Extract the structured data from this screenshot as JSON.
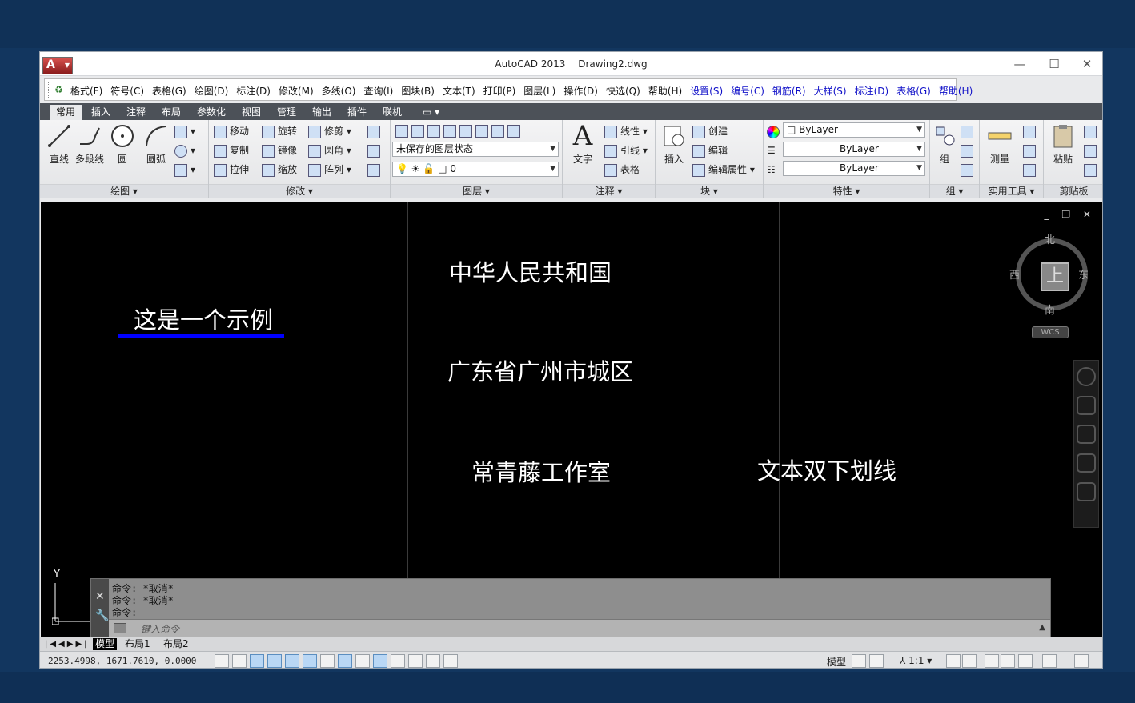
{
  "window": {
    "app_name": "AutoCAD 2013",
    "file_name": "Drawing2.dwg",
    "min_glyph": "—",
    "max_glyph": "☐",
    "close_glyph": "✕"
  },
  "menubar": {
    "items": [
      {
        "label": "格式(F)",
        "color": "black"
      },
      {
        "label": "符号(C)",
        "color": "black"
      },
      {
        "label": "表格(G)",
        "color": "black"
      },
      {
        "label": "绘图(D)",
        "color": "black"
      },
      {
        "label": "标注(D)",
        "color": "black"
      },
      {
        "label": "修改(M)",
        "color": "black"
      },
      {
        "label": "多线(O)",
        "color": "black"
      },
      {
        "label": "查询(I)",
        "color": "black"
      },
      {
        "label": "图块(B)",
        "color": "black"
      },
      {
        "label": "文本(T)",
        "color": "black"
      },
      {
        "label": "打印(P)",
        "color": "black"
      },
      {
        "label": "图层(L)",
        "color": "black"
      },
      {
        "label": "操作(D)",
        "color": "black"
      },
      {
        "label": "快选(Q)",
        "color": "black"
      },
      {
        "label": "帮助(H)",
        "color": "black"
      },
      {
        "label": "设置(S)",
        "color": "blue"
      },
      {
        "label": "编号(C)",
        "color": "blue"
      },
      {
        "label": "钢筋(R)",
        "color": "blue"
      },
      {
        "label": "大样(S)",
        "color": "blue"
      },
      {
        "label": "标注(D)",
        "color": "blue"
      },
      {
        "label": "表格(G)",
        "color": "blue"
      },
      {
        "label": "帮助(H)",
        "color": "blue"
      }
    ]
  },
  "ribbon_tabs": [
    "常用",
    "插入",
    "注释",
    "布局",
    "参数化",
    "视图",
    "管理",
    "输出",
    "插件",
    "联机"
  ],
  "ribbon_tab_extra": "▭ ▾",
  "panels": {
    "draw": {
      "title": "绘图",
      "line": "直线",
      "polyline": "多段线",
      "circle": "圆",
      "arc": "圆弧"
    },
    "modify": {
      "title": "修改",
      "move": "移动",
      "rotate": "旋转",
      "trim": "修剪",
      "copy": "复制",
      "mirror": "镜像",
      "fillet": "圆角",
      "stretch": "拉伸",
      "scale": "缩放",
      "array": "阵列"
    },
    "layers": {
      "title": "图层",
      "state": "未保存的图层状态",
      "current": "0"
    },
    "annotation": {
      "title": "注释",
      "text": "文字",
      "linear": "线性",
      "leader": "引线",
      "table": "表格"
    },
    "block": {
      "title": "块",
      "insert": "插入",
      "create": "创建",
      "edit": "编辑",
      "edit_attr": "编辑属性"
    },
    "properties": {
      "title": "特性",
      "color": "ByLayer",
      "linetype": "ByLayer",
      "lineweight": "ByLayer"
    },
    "groups": {
      "title": "组",
      "group": "组"
    },
    "utilities": {
      "title": "实用工具",
      "measure": "测量"
    },
    "clipboard": {
      "title": "剪贴板",
      "paste": "粘贴"
    }
  },
  "drawing": {
    "texts": [
      "中华人民共和国",
      "这是一个示例",
      "广东省广州市城区",
      "常青藤工作室",
      "文本双下划线"
    ],
    "underline_color": "#0000ff",
    "viewport_controls": "_ ❐ ✕"
  },
  "viewcube": {
    "north": "北",
    "south": "南",
    "east": "东",
    "west": "西",
    "face": "上",
    "wcs": "WCS"
  },
  "ucs": {
    "y_label": "Y"
  },
  "command": {
    "history": [
      "命令: *取消*",
      "命令: *取消*",
      "命令:"
    ],
    "placeholder": "键入命令"
  },
  "layout_tabs": {
    "model": "模型",
    "layout1": "布局1",
    "layout2": "布局2"
  },
  "status": {
    "coords": "2253.4998, 1671.7610, 0.0000",
    "model_label": "模型",
    "scale": "1:1"
  }
}
